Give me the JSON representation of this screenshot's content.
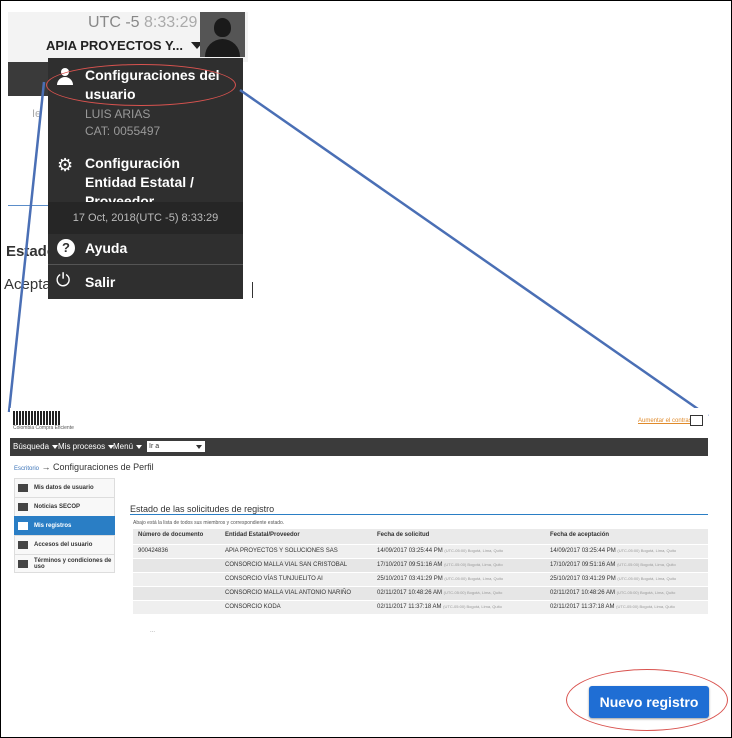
{
  "header": {
    "timezone_label": "UTC -5",
    "time": "8:33:29",
    "entity_name": "APIA PROYECTOS Y..."
  },
  "background_fragments": {
    "fragment_ie": "Ie",
    "estado": "Estado",
    "aceptacion": "Aceptac"
  },
  "user_menu": {
    "user_config_label": "Configuraciones del usuario",
    "user_name": "LUIS ARIAS",
    "user_code": "CAT: 0055497",
    "entity_config_label": "Configuración Entidad Estatal / Proveedor",
    "datetime": "17 Oct, 2018(UTC -5) 8:33:29",
    "help_label": "Ayuda",
    "exit_label": "Salir"
  },
  "app": {
    "logo_text": "Colombia Compra Eficiente",
    "report_link": "Aumentar el contraste",
    "nav": {
      "search": "Búsqueda",
      "processes": "Mis procesos",
      "menu": "Menú",
      "goto_value": "Ir a"
    },
    "breadcrumb": {
      "home": "Escritorio",
      "arrow": "→",
      "current": "Configuraciones de Perfil"
    },
    "sidebar": [
      {
        "label": "Mis datos de usuario",
        "active": false
      },
      {
        "label": "Noticias SECOP",
        "active": false
      },
      {
        "label": "Mis registros",
        "active": true
      },
      {
        "label": "Accesos del usuario",
        "active": false
      },
      {
        "label": "Términos y condiciones de uso",
        "active": false
      }
    ],
    "section_title": "Estado de las solicitudes de registro",
    "section_subtitle": "Abajo está la lista de todos sus miembros y correspondiente estado.",
    "table": {
      "headers": [
        "Número de documento",
        "Entidad Estatal/Proveedor",
        "Fecha de solicitud",
        "Fecha de aceptación"
      ],
      "tz_note": "(UTC-05:00) Bogotá, Lima, Quito",
      "rows": [
        {
          "doc": "900424836",
          "entity": "APIA PROYECTOS Y SOLUCIONES SAS",
          "requested": "14/09/2017 03:25:44 PM",
          "accepted": "14/09/2017 03:25:44 PM"
        },
        {
          "doc": "",
          "entity": "CONSORCIO MALLA VIAL SAN CRISTOBAL",
          "requested": "17/10/2017 09:51:16 AM",
          "accepted": "17/10/2017 09:51:16 AM"
        },
        {
          "doc": "",
          "entity": "CONSORCIO VÍAS TUNJUELITO AI",
          "requested": "25/10/2017 03:41:29 PM",
          "accepted": "25/10/2017 03:41:29 PM"
        },
        {
          "doc": "",
          "entity": "CONSORCIO MALLA VIAL ANTONIO NARIÑO",
          "requested": "02/11/2017 10:48:26 AM",
          "accepted": "02/11/2017 10:48:26 AM"
        },
        {
          "doc": "",
          "entity": "CONSORCIO KODA",
          "requested": "02/11/2017 11:37:18 AM",
          "accepted": "02/11/2017 11:37:18 AM"
        }
      ]
    },
    "tail_text": "..."
  },
  "new_button_label": "Nuevo registro",
  "colors": {
    "menu_bg": "#2f2f2f",
    "accent_blue": "#1f6ed4",
    "highlight_red": "#d9534f",
    "connector_blue": "#4a6fb5"
  }
}
